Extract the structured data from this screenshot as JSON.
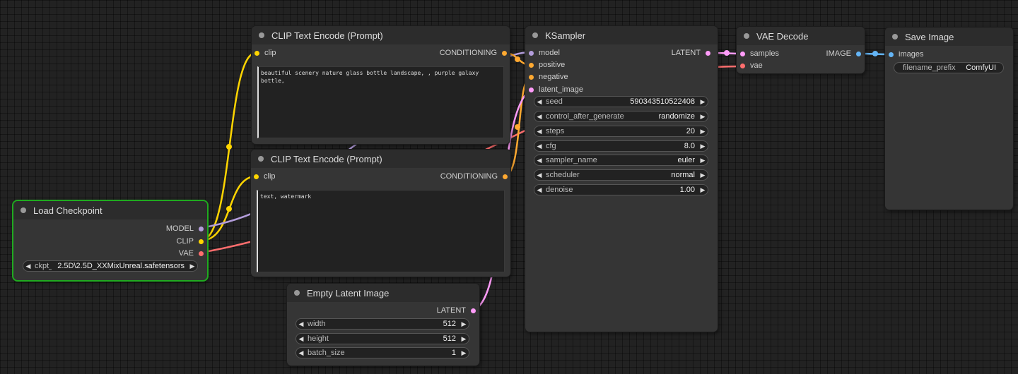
{
  "colors": {
    "model": "#b39ddb",
    "clip": "#ffd500",
    "vae": "#ff6e6e",
    "conditioning": "#ffa931",
    "latent": "#ff9cf9",
    "image": "#64b5f6"
  },
  "nodes": {
    "load_checkpoint": {
      "title": "Load Checkpoint",
      "outputs": [
        "MODEL",
        "CLIP",
        "VAE"
      ],
      "widget_name": "ckpt_name",
      "widget_value": "2.5D\\2.5D_XXMixUnreal.safetensors"
    },
    "clip_pos": {
      "title": "CLIP Text Encode (Prompt)",
      "input": "clip",
      "output": "CONDITIONING",
      "text": "beautiful scenery nature glass bottle landscape, , purple galaxy bottle,"
    },
    "clip_neg": {
      "title": "CLIP Text Encode (Prompt)",
      "input": "clip",
      "output": "CONDITIONING",
      "text": "text, watermark"
    },
    "empty_latent": {
      "title": "Empty Latent Image",
      "output": "LATENT",
      "widgets": [
        {
          "name": "width",
          "value": "512"
        },
        {
          "name": "height",
          "value": "512"
        },
        {
          "name": "batch_size",
          "value": "1"
        }
      ]
    },
    "ksampler": {
      "title": "KSampler",
      "inputs": [
        "model",
        "positive",
        "negative",
        "latent_image"
      ],
      "output": "LATENT",
      "widgets": [
        {
          "name": "seed",
          "value": "590343510522408"
        },
        {
          "name": "control_after_generate",
          "value": "randomize"
        },
        {
          "name": "steps",
          "value": "20"
        },
        {
          "name": "cfg",
          "value": "8.0"
        },
        {
          "name": "sampler_name",
          "value": "euler"
        },
        {
          "name": "scheduler",
          "value": "normal"
        },
        {
          "name": "denoise",
          "value": "1.00"
        }
      ]
    },
    "vae_decode": {
      "title": "VAE Decode",
      "inputs": [
        "samples",
        "vae"
      ],
      "output": "IMAGE"
    },
    "save_image": {
      "title": "Save Image",
      "input": "images",
      "widget_name": "filename_prefix",
      "widget_value": "ComfyUI"
    }
  }
}
